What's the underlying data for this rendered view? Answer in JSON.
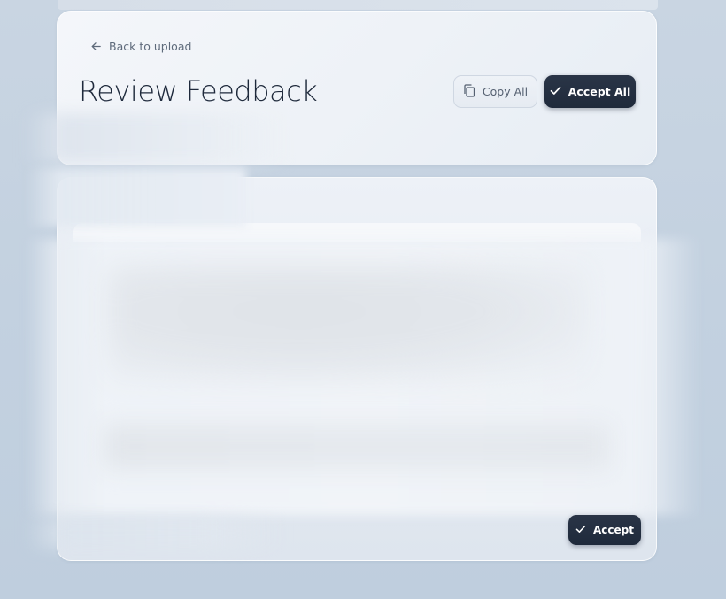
{
  "header": {
    "back_label": "Back to upload",
    "title": "Review Feedback",
    "copy_all_label": "Copy All",
    "accept_all_label": "Accept All"
  },
  "suggestion": {
    "accept_label": "Accept"
  },
  "icons": {
    "back": "arrow-left-icon",
    "copy": "copy-icon",
    "check": "check-icon"
  },
  "colors": {
    "primary_button": "#1f2a3b",
    "background": "#c3d1e0"
  }
}
